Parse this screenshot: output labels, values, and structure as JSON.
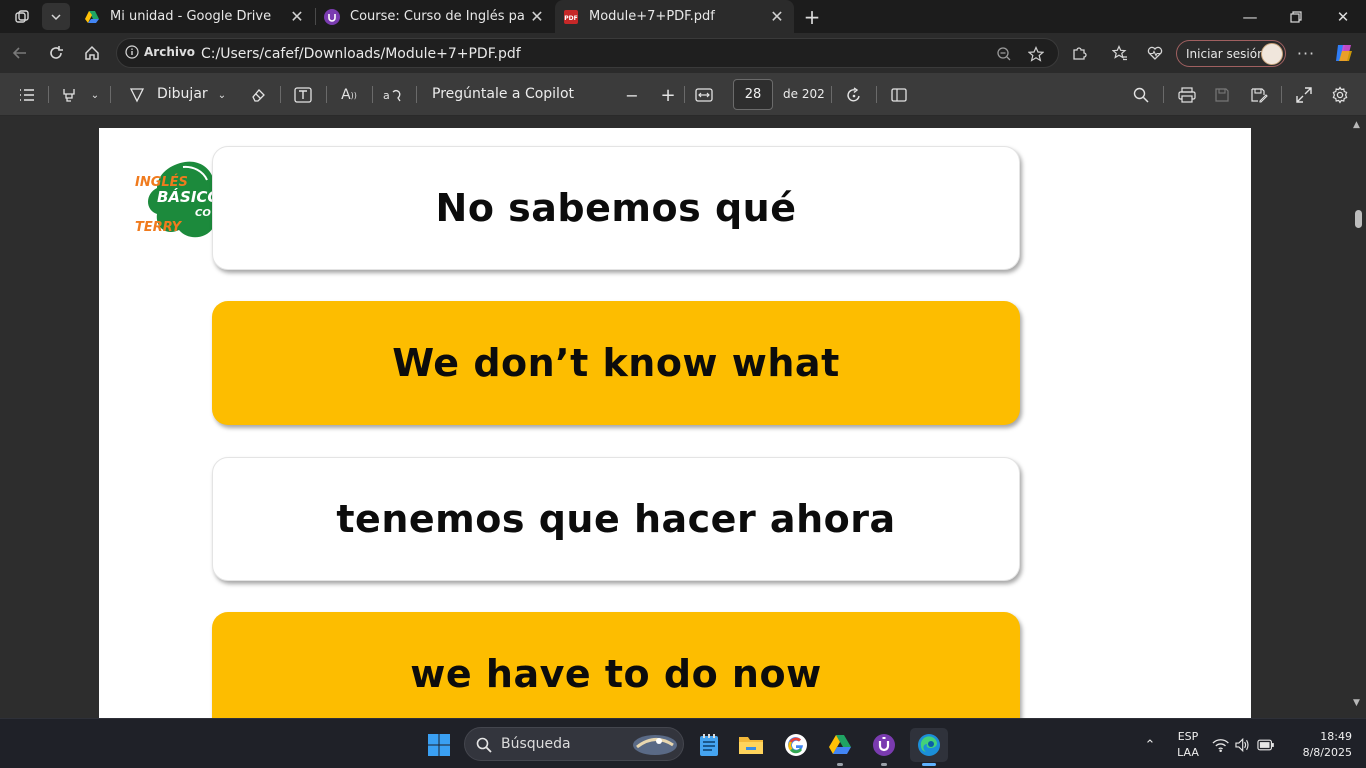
{
  "tabs": [
    {
      "title": "Mi unidad - Google Drive",
      "icon": "google-drive-icon"
    },
    {
      "title": "Course: Curso de Inglés para principiantes",
      "icon": "udemy-icon"
    },
    {
      "title": "Module+7+PDF.pdf",
      "icon": "pdf-icon",
      "active": true
    }
  ],
  "address": {
    "info_label": "Archivo",
    "url": "C:/Users/cafef/Downloads/Module+7+PDF.pdf",
    "signin_label": "Iniciar sesión"
  },
  "pdf_toolbar": {
    "draw_label": "Dibujar",
    "copilot_label": "Pregúntale a Copilot",
    "current_page": "28",
    "page_total": "de 202"
  },
  "slide": {
    "logo_text": [
      "INGLÉS",
      "BÁSICO",
      "TERRY",
      "CO"
    ],
    "cards": [
      {
        "text": "No sabemos qué",
        "style": "white"
      },
      {
        "text": "We don’t know what",
        "style": "yellow"
      },
      {
        "text": "tenemos que hacer ahora",
        "style": "white"
      },
      {
        "text": "we have to do now",
        "style": "yellow"
      }
    ]
  },
  "taskbar": {
    "search_placeholder": "Búsqueda",
    "language": "ESP",
    "layout": "LAA",
    "time": "18:49",
    "date": "8/8/2025"
  },
  "colors": {
    "card_yellow": "#fdbd00",
    "logo_green": "#1c8a3c",
    "logo_orange": "#f07b1e"
  }
}
